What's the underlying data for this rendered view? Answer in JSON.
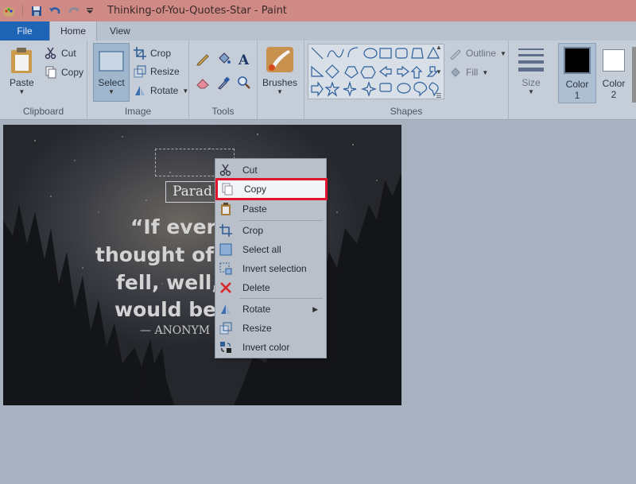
{
  "window": {
    "title": "Thinking-of-You-Quotes-Star - Paint"
  },
  "tabs": [
    {
      "label": "File"
    },
    {
      "label": "Home"
    },
    {
      "label": "View"
    }
  ],
  "ribbon": {
    "clipboard": {
      "label": "Clipboard",
      "paste": "Paste",
      "cut": "Cut",
      "copy": "Copy"
    },
    "image": {
      "label": "Image",
      "select": "Select",
      "crop": "Crop",
      "resize": "Resize",
      "rotate": "Rotate"
    },
    "tools": {
      "label": "Tools"
    },
    "brushes": {
      "label": "Brushes"
    },
    "shapes": {
      "label": "Shapes",
      "outline": "Outline",
      "fill": "Fill"
    },
    "size": {
      "label": "Size"
    },
    "color1": {
      "label": "Color",
      "num": "1",
      "value": "#000000"
    },
    "color2": {
      "label": "Color",
      "num": "2",
      "value": "#ffffff"
    }
  },
  "image": {
    "badge": "Parad",
    "quote_lines": [
      "“If every",
      "thought of y",
      "fell, well,",
      "would be c"
    ],
    "author": "— ANONYM"
  },
  "context_menu": {
    "items": [
      {
        "label": "Cut",
        "icon": "scissors-icon"
      },
      {
        "label": "Copy",
        "icon": "copy-icon",
        "highlighted": true
      },
      {
        "label": "Paste",
        "icon": "paste-icon"
      },
      {
        "label": "Crop",
        "icon": "crop-icon"
      },
      {
        "label": "Select all",
        "icon": "select-all-icon"
      },
      {
        "label": "Invert selection",
        "icon": "invert-selection-icon"
      },
      {
        "label": "Delete",
        "icon": "delete-icon"
      },
      {
        "label": "Rotate",
        "icon": "rotate-icon"
      },
      {
        "label": "Resize",
        "icon": "resize-icon"
      },
      {
        "label": "Invert color",
        "icon": "invert-color-icon"
      }
    ]
  },
  "colors": {
    "highlight_border": "#e0142c",
    "file_tab": "#1e64b4",
    "titlebar": "#d08a86"
  }
}
